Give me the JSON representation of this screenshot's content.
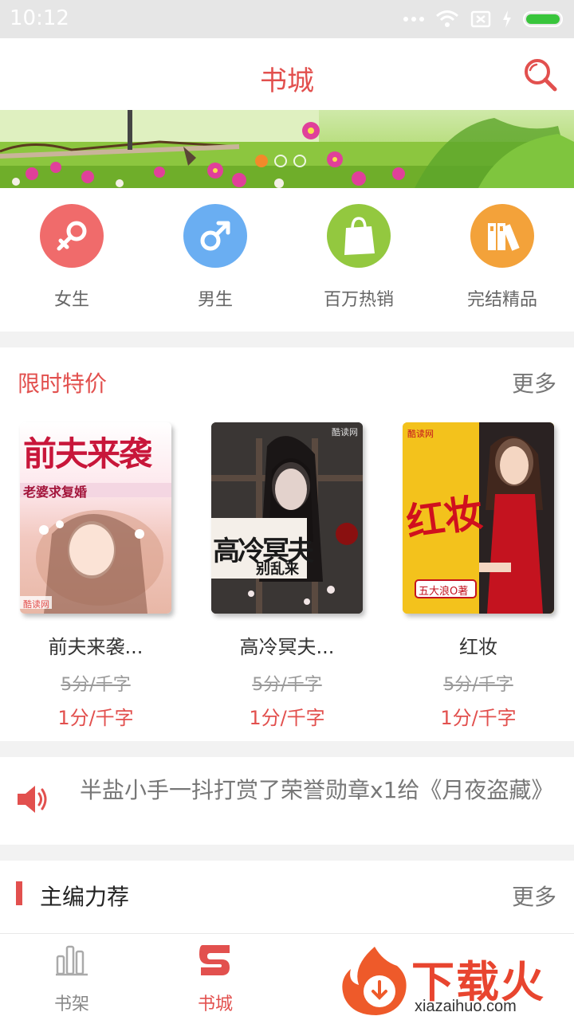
{
  "status_bar": {
    "time": "10:12"
  },
  "header": {
    "title": "书城"
  },
  "banner": {
    "slide_count": 3,
    "active_slide": 0
  },
  "categories": [
    {
      "label": "女生",
      "icon": "female-icon",
      "color": "#f06b6b"
    },
    {
      "label": "男生",
      "icon": "male-icon",
      "color": "#6aaef2"
    },
    {
      "label": "百万热销",
      "icon": "shopping-bag-icon",
      "color": "#93c83f"
    },
    {
      "label": "完结精品",
      "icon": "books-icon",
      "color": "#f3a23a"
    }
  ],
  "limited_sale": {
    "title": "限时特价",
    "more": "更多",
    "books": [
      {
        "name": "前夫来袭...",
        "old_price": "5分/千字",
        "new_price": "1分/千字",
        "cover_text": "前夫来袭",
        "cover_sub": "老婆求复婚",
        "cover_brand": "酷读网"
      },
      {
        "name": "高冷冥夫...",
        "old_price": "5分/千字",
        "new_price": "1分/千字",
        "cover_text": "高冷冥夫",
        "cover_sub": "别乱来",
        "cover_brand": "酷读网"
      },
      {
        "name": "红妆",
        "old_price": "5分/千字",
        "new_price": "1分/千字",
        "cover_text": "红妆",
        "cover_sub": "五大浪O著",
        "cover_brand": "酷读网"
      }
    ]
  },
  "notice": {
    "message": "半盐小手一抖打赏了荣誉勋章x1给《月夜盗藏》"
  },
  "editor_picks": {
    "title": "主编力荐",
    "more": "更多"
  },
  "tabs": [
    {
      "label": "书架",
      "icon": "bookshelf-icon"
    },
    {
      "label": "书城",
      "icon": "bookstore-icon",
      "active": true
    }
  ],
  "watermark": {
    "text": "下载火",
    "url": "xiazaihuo.com"
  }
}
